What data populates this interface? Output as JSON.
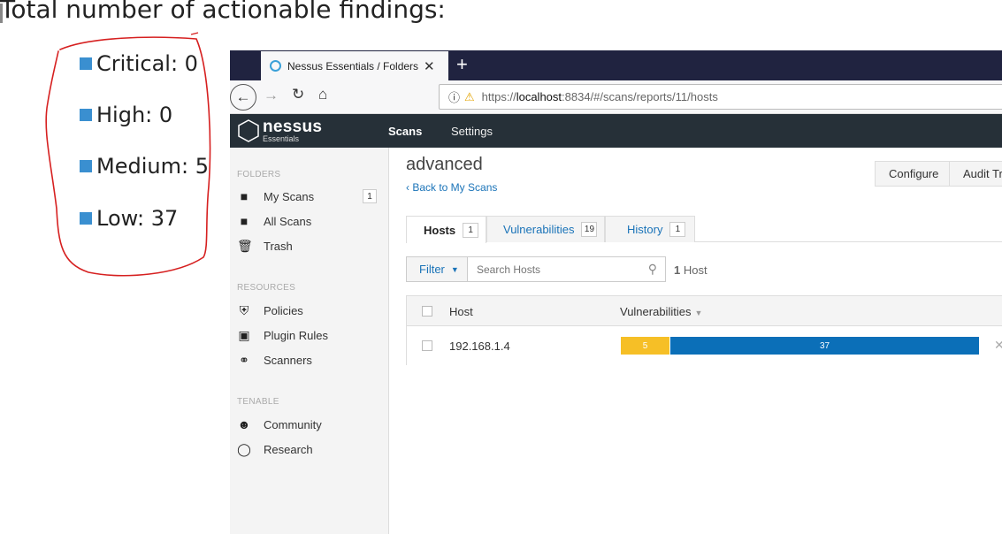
{
  "slide": {
    "title": "Total number of actionable findings:",
    "bullets": [
      {
        "label": "Critical:",
        "value": "0"
      },
      {
        "label": "High:",
        "value": "0"
      },
      {
        "label": "Medium:",
        "value": "5"
      },
      {
        "label": "Low:",
        "value": "37"
      }
    ],
    "bullet_color": "#3a8fd0",
    "annotation_color": "#d62020"
  },
  "browser": {
    "tab_title": "Nessus Essentials / Folders / View Scan",
    "tab_close": "✕",
    "new_tab": "+",
    "url_prefix": "https://",
    "url_host": "localhost",
    "url_path": ":8834/#/scans/reports/11/hosts"
  },
  "app": {
    "logo_name": "nessus",
    "logo_sub": "Essentials",
    "nav": {
      "scans": "Scans",
      "settings": "Settings"
    },
    "header_color": "#263038"
  },
  "sidebar": {
    "folders_heading": "FOLDERS",
    "resources_heading": "RESOURCES",
    "tenable_heading": "TENABLE",
    "folders": [
      {
        "label": "My Scans",
        "count": "1",
        "icon": "folder-icon"
      },
      {
        "label": "All Scans",
        "icon": "folder-icon"
      },
      {
        "label": "Trash",
        "icon": "trash-icon"
      }
    ],
    "resources": [
      {
        "label": "Policies",
        "icon": "shield-icon"
      },
      {
        "label": "Plugin Rules",
        "icon": "plug-icon"
      },
      {
        "label": "Scanners",
        "icon": "satellite-icon"
      }
    ],
    "tenable": [
      {
        "label": "Community",
        "icon": "people-icon"
      },
      {
        "label": "Research",
        "icon": "lightbulb-icon"
      }
    ]
  },
  "main": {
    "scan_title": "advanced",
    "back_link": "‹ Back to My Scans",
    "configure": "Configure",
    "audit_trail": "Audit Trail",
    "tabs": [
      {
        "label": "Hosts",
        "count": "1"
      },
      {
        "label": "Vulnerabilities",
        "count": "19"
      },
      {
        "label": "History",
        "count": "1"
      }
    ],
    "filter": "Filter",
    "search_placeholder": "Search Hosts",
    "host_count_num": "1",
    "host_count_label": "Host",
    "columns": {
      "host": "Host",
      "vulnerabilities": "Vulnerabilities"
    },
    "rows": [
      {
        "host": "192.168.1.4",
        "medium": "5",
        "low": "37"
      }
    ],
    "severity_colors": {
      "medium": "#f6bf26",
      "low": "#0b6fb8"
    }
  }
}
